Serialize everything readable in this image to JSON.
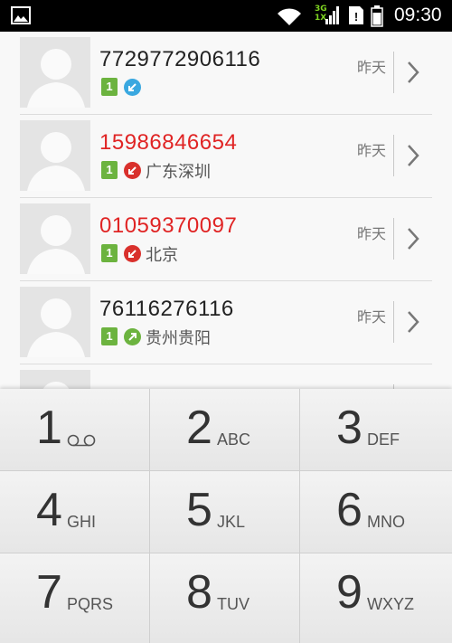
{
  "status_bar": {
    "network_label_top": "3G",
    "network_label_bottom": "1X",
    "time": "09:30"
  },
  "call_log": [
    {
      "number": "7729772906116",
      "missed": false,
      "sim": "1",
      "direction": "incoming",
      "direction_color": "#3aa8e0",
      "location": "",
      "time": "昨天"
    },
    {
      "number": "15986846654",
      "missed": true,
      "sim": "1",
      "direction": "missed",
      "direction_color": "#d9302c",
      "location": "广东深圳",
      "time": "昨天"
    },
    {
      "number": "01059370097",
      "missed": true,
      "sim": "1",
      "direction": "missed",
      "direction_color": "#d9302c",
      "location": "北京",
      "time": "昨天"
    },
    {
      "number": "76116276116",
      "missed": false,
      "sim": "1",
      "direction": "outgoing",
      "direction_color": "#6cb33f",
      "location": "贵州贵阳",
      "time": "昨天"
    }
  ],
  "dialpad": {
    "keys": [
      {
        "digit": "1",
        "letters": "",
        "voicemail": true
      },
      {
        "digit": "2",
        "letters": "ABC"
      },
      {
        "digit": "3",
        "letters": "DEF"
      },
      {
        "digit": "4",
        "letters": "GHI"
      },
      {
        "digit": "5",
        "letters": "JKL"
      },
      {
        "digit": "6",
        "letters": "MNO"
      },
      {
        "digit": "7",
        "letters": "PQRS"
      },
      {
        "digit": "8",
        "letters": "TUV"
      },
      {
        "digit": "9",
        "letters": "WXYZ"
      }
    ]
  },
  "colors": {
    "missed_number": "#e02424",
    "sim_badge": "#6cb33f",
    "incoming": "#3aa8e0",
    "missed": "#d9302c",
    "outgoing": "#6cb33f"
  }
}
